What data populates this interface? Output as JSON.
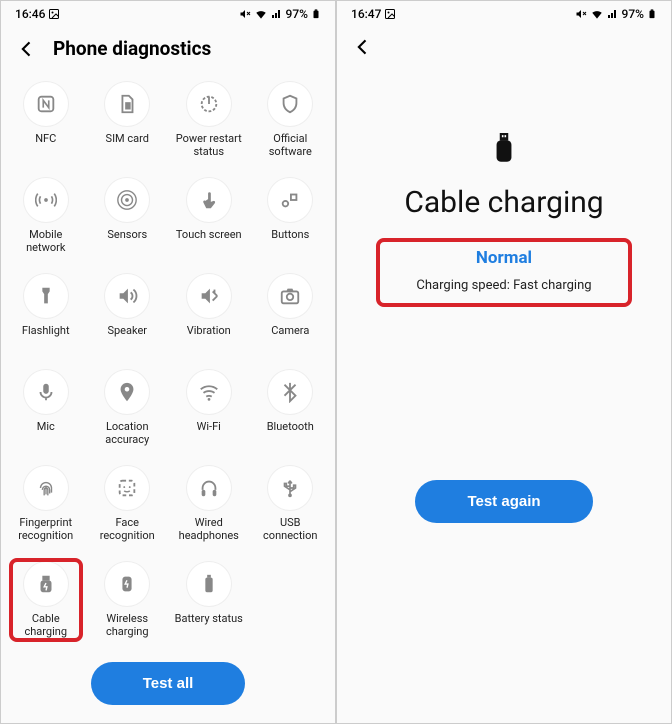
{
  "screen1": {
    "status": {
      "time": "16:46",
      "battery": "97%"
    },
    "title": "Phone diagnostics",
    "items": [
      {
        "label": "NFC",
        "icon": "nfc"
      },
      {
        "label": "SIM card",
        "icon": "sim"
      },
      {
        "label": "Power restart\nstatus",
        "icon": "power"
      },
      {
        "label": "Official\nsoftware",
        "icon": "shield"
      },
      {
        "label": "Mobile\nnetwork",
        "icon": "antenna"
      },
      {
        "label": "Sensors",
        "icon": "sensors"
      },
      {
        "label": "Touch screen",
        "icon": "touch"
      },
      {
        "label": "Buttons",
        "icon": "buttons"
      },
      {
        "label": "Flashlight",
        "icon": "flashlight"
      },
      {
        "label": "Speaker",
        "icon": "speaker"
      },
      {
        "label": "Vibration",
        "icon": "vibration"
      },
      {
        "label": "Camera",
        "icon": "camera"
      },
      {
        "label": "Mic",
        "icon": "mic"
      },
      {
        "label": "Location\naccuracy",
        "icon": "location"
      },
      {
        "label": "Wi-Fi",
        "icon": "wifi"
      },
      {
        "label": "Bluetooth",
        "icon": "bluetooth"
      },
      {
        "label": "Fingerprint\nrecognition",
        "icon": "fingerprint"
      },
      {
        "label": "Face\nrecognition",
        "icon": "face"
      },
      {
        "label": "Wired\nheadphones",
        "icon": "headphones"
      },
      {
        "label": "USB\nconnection",
        "icon": "usb"
      },
      {
        "label": "Cable\ncharging",
        "icon": "cable-charge",
        "highlight": true
      },
      {
        "label": "Wireless\ncharging",
        "icon": "wireless-charge"
      },
      {
        "label": "Battery status",
        "icon": "battery"
      }
    ],
    "testAll": "Test all"
  },
  "screen2": {
    "status": {
      "time": "16:47",
      "battery": "97%"
    },
    "title": "Cable charging",
    "resultStatus": "Normal",
    "resultDetail": "Charging speed: Fast charging",
    "testAgain": "Test again"
  }
}
